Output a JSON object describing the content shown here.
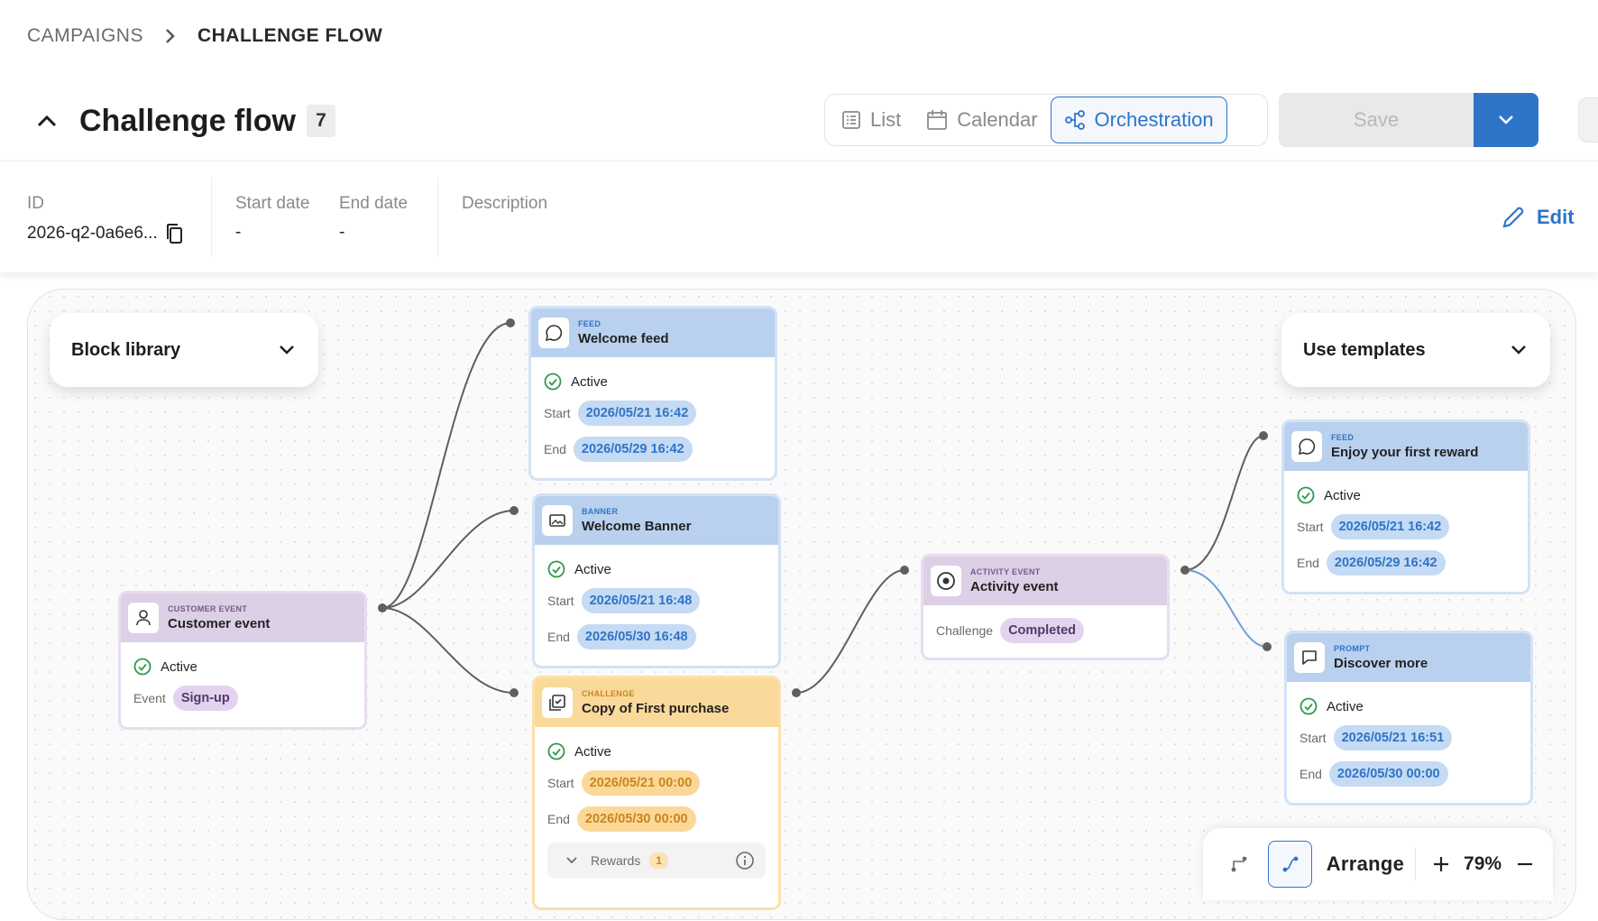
{
  "breadcrumb": {
    "parent": "CAMPAIGNS",
    "current": "CHALLENGE FLOW"
  },
  "header": {
    "title": "Challenge flow",
    "count": "7"
  },
  "view_switch": {
    "list": "List",
    "calendar": "Calendar",
    "orchestration": "Orchestration",
    "active": "Orchestration"
  },
  "toolbar": {
    "save_label": "Save"
  },
  "info": {
    "id_label": "ID",
    "id_value": "2026-q2-0a6e6...",
    "start_label": "Start date",
    "start_value": "-",
    "end_label": "End date",
    "end_value": "-",
    "description_label": "Description",
    "edit_label": "Edit"
  },
  "canvas": {
    "block_library": "Block library",
    "use_templates": "Use templates",
    "nodes": {
      "customer_event": {
        "type": "CUSTOMER EVENT",
        "name": "Customer event",
        "status": "Active",
        "kv_label": "Event",
        "kv_value": "Sign-up"
      },
      "welcome_feed": {
        "type": "FEED",
        "name": "Welcome feed",
        "status": "Active",
        "start_label": "Start",
        "start": "2026/05/21 16:42",
        "end_label": "End",
        "end": "2026/05/29 16:42"
      },
      "welcome_banner": {
        "type": "BANNER",
        "name": "Welcome Banner",
        "status": "Active",
        "start_label": "Start",
        "start": "2026/05/21 16:48",
        "end_label": "End",
        "end": "2026/05/30 16:48"
      },
      "challenge": {
        "type": "CHALLENGE",
        "name": "Copy of First purchase",
        "status": "Active",
        "start_label": "Start",
        "start": "2026/05/21 00:00",
        "end_label": "End",
        "end": "2026/05/30 00:00",
        "rewards_label": "Rewards",
        "rewards_count": "1"
      },
      "activity_event": {
        "type": "ACTIVITY EVENT",
        "name": "Activity event",
        "kv_label": "Challenge",
        "kv_value": "Completed"
      },
      "reward_feed": {
        "type": "FEED",
        "name": "Enjoy your first reward",
        "status": "Active",
        "start_label": "Start",
        "start": "2026/05/21 16:42",
        "end_label": "End",
        "end": "2026/05/29 16:42"
      },
      "prompt": {
        "type": "PROMPT",
        "name": "Discover more",
        "status": "Active",
        "start_label": "Start",
        "start": "2026/05/21 16:51",
        "end_label": "End",
        "end": "2026/05/30 00:00"
      }
    }
  },
  "bottom_toolbar": {
    "arrange_label": "Arrange",
    "zoom": "79%"
  },
  "colors": {
    "accent": "#2e74c9",
    "feed_header": "#b9d1ee",
    "event_header": "#dccfe6",
    "challenge_header": "#fad99a",
    "status_green": "#2e9a4a"
  }
}
